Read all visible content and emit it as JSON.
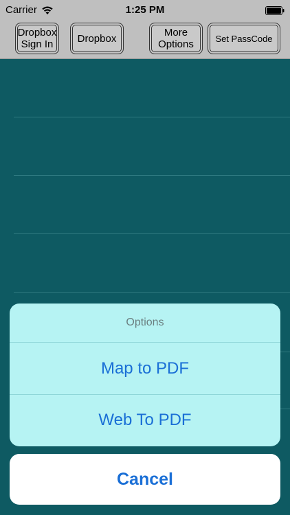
{
  "status_bar": {
    "carrier": "Carrier",
    "time": "1:25 PM"
  },
  "toolbar": {
    "dropbox_sign_in": "Dropbox\nSign In",
    "dropbox": "Dropbox",
    "more_options": "More\nOptions",
    "set_passcode": "Set PassCode"
  },
  "action_sheet": {
    "title": "Options",
    "actions": [
      {
        "label": "Map to PDF"
      },
      {
        "label": "Web To PDF"
      }
    ],
    "cancel_label": "Cancel"
  },
  "colors": {
    "accent": "#1a6fd6",
    "sheet_bg": "#b6f3f3",
    "list_bg": "#0e5a62",
    "bar_bg": "#bfbfbf"
  },
  "icons": [
    "wifi-icon",
    "battery-icon"
  ]
}
